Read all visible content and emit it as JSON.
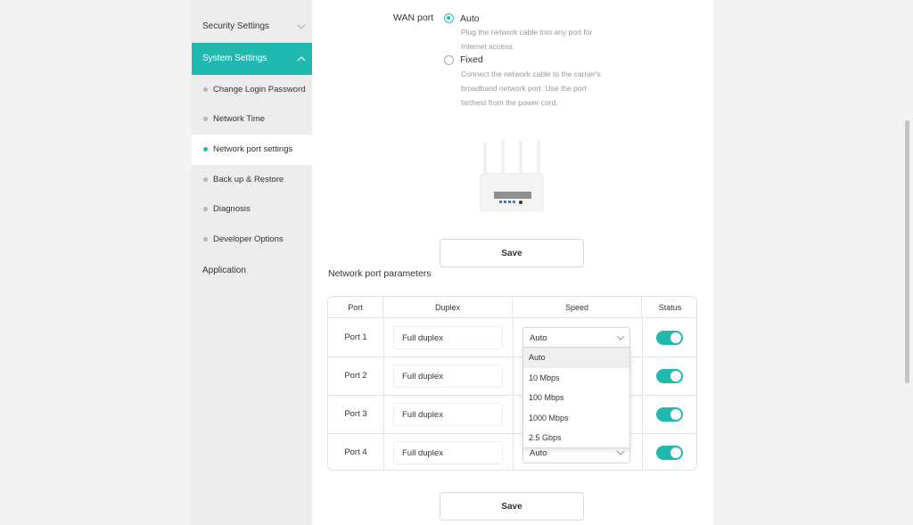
{
  "sidebar": {
    "groups": [
      {
        "label": "Security Settings"
      },
      {
        "label": "System Settings"
      },
      {
        "label": "Application"
      }
    ],
    "items": [
      {
        "label": "Change Login Password"
      },
      {
        "label": "Network Time"
      },
      {
        "label": "Network port settings"
      },
      {
        "label": "Back up & Restore"
      },
      {
        "label": "Diagnosis"
      },
      {
        "label": "Developer Options"
      }
    ]
  },
  "wan": {
    "label": "WAN port",
    "options": [
      {
        "label": "Auto",
        "desc_lines": [
          "Plug the network cable into any port for",
          "Internet access"
        ],
        "selected": true
      },
      {
        "label": "Fixed",
        "desc_lines": [
          "Connect the network cable to the carrier's",
          "broadband network port. Use the port",
          "farthest from the power cord."
        ],
        "selected": false
      }
    ]
  },
  "save_label": "Save",
  "port_params": {
    "title": "Network port parameters",
    "headers": [
      "Port",
      "Duplex",
      "Speed",
      "Status"
    ],
    "rows": [
      {
        "port": "Port 1",
        "duplex": "Full duplex",
        "speed": "Auto",
        "status": true
      },
      {
        "port": "Port 2",
        "duplex": "Full duplex",
        "speed": "",
        "status": true
      },
      {
        "port": "Port 3",
        "duplex": "Full duplex",
        "speed": "",
        "status": true
      },
      {
        "port": "Port 4",
        "duplex": "Full duplex",
        "speed": "Auto",
        "status": true
      }
    ],
    "speed_options": [
      "Auto",
      "10 Mbps",
      "100 Mbps",
      "1000 Mbps",
      "2.5 Gbps"
    ],
    "highlighted_option": "Auto"
  },
  "colors": {
    "accent": "#21b8b0"
  }
}
